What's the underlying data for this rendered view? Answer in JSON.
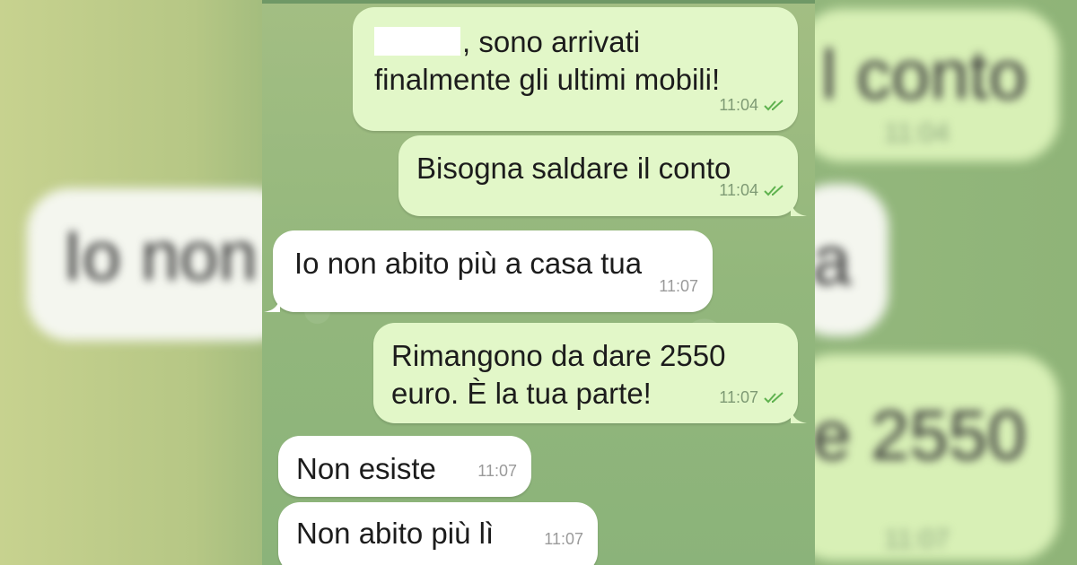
{
  "backdrop": {
    "left_bubble_text": "Io non",
    "right_top_text": "l conto",
    "right_top_time": "11:04",
    "right_mid_text": "a",
    "right_bottom_text": "e 2550",
    "right_bottom_time": "11:07"
  },
  "messages": [
    {
      "direction": "out",
      "redacted_prefix": true,
      "text_line1": ", sono arrivati",
      "text_line2": "finalmente gli ultimi mobili!",
      "time": "11:04",
      "read": true
    },
    {
      "direction": "out",
      "text": "Bisogna saldare il conto",
      "time": "11:04",
      "read": true
    },
    {
      "direction": "in",
      "text": "Io non abito più a casa tua",
      "time": "11:07"
    },
    {
      "direction": "out",
      "text_line1": "Rimangono da dare 2550",
      "text_line2": "euro. È la tua parte!",
      "time": "11:07",
      "read": true
    },
    {
      "direction": "in",
      "text": "Non esiste",
      "time": "11:07"
    },
    {
      "direction": "in",
      "text": "Non abito più lì",
      "time": "11:07"
    }
  ],
  "colors": {
    "outgoing_bubble": "#e2f7c8",
    "incoming_bubble": "#ffffff",
    "read_check": "#5fb24f",
    "chat_background": "#8fb27a"
  },
  "icons": {
    "read_receipt": "double-check-icon"
  }
}
